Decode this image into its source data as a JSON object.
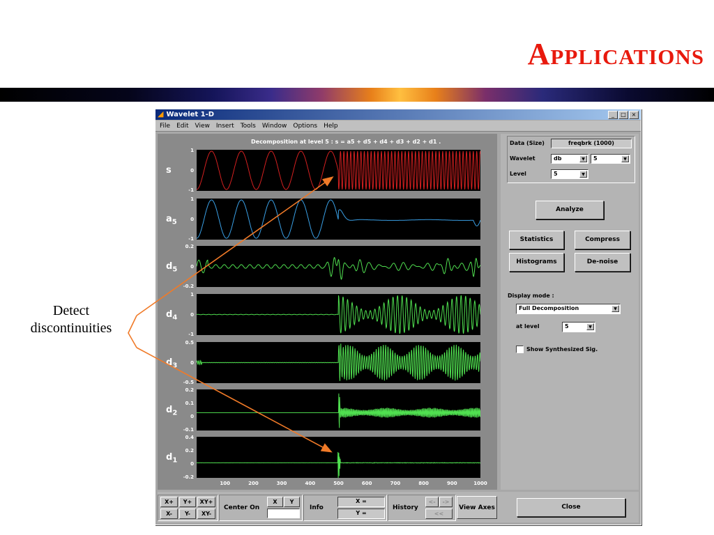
{
  "slide": {
    "title": "Applications",
    "annotation_line1": "Detect",
    "annotation_line2": "discontinuities"
  },
  "colors": {
    "title_red": "#e8190d",
    "arrow_orange": "#f07a28",
    "signal_red": "#d42020",
    "approx_blue": "#3aa0e6",
    "detail_green": "#50e050",
    "titlebar_blue": "#0a2a7a"
  },
  "window": {
    "icon": "matlab-icon",
    "title": "Wavelet 1-D",
    "controls": [
      "_",
      "□",
      "×"
    ],
    "menu": [
      "File",
      "Edit",
      "View",
      "Insert",
      "Tools",
      "Window",
      "Options",
      "Help"
    ]
  },
  "plot_title": "Decomposition at level 5 : s = a5 + d5 + d4 + d3 + d2 + d1 .",
  "subplots": [
    {
      "label": "s",
      "sub": "",
      "yticks": [
        "1",
        "0",
        "-1"
      ]
    },
    {
      "label": "a",
      "sub": "5",
      "yticks": [
        "1",
        "0",
        "-1"
      ]
    },
    {
      "label": "d",
      "sub": "5",
      "yticks": [
        "0.2",
        "0",
        "-0.2"
      ]
    },
    {
      "label": "d",
      "sub": "4",
      "yticks": [
        "1",
        "0",
        "-1"
      ]
    },
    {
      "label": "d",
      "sub": "3",
      "yticks": [
        "0.5",
        "0",
        "-0.5"
      ]
    },
    {
      "label": "d",
      "sub": "2",
      "yticks": [
        "0.2",
        "0.1",
        "0",
        "-0.1"
      ]
    },
    {
      "label": "d",
      "sub": "1",
      "yticks": [
        "0.4",
        "0.2",
        "0",
        "-0.2"
      ]
    }
  ],
  "chart_data": {
    "type": "line",
    "x_range": [
      0,
      1000
    ],
    "discontinuity_at": 500,
    "xticks": [
      "100",
      "200",
      "300",
      "400",
      "500",
      "600",
      "700",
      "800",
      "900",
      "1000"
    ]
  },
  "panel": {
    "data_label": "Data  (Size)",
    "data_value": "freqbrk  (1000)",
    "wavelet_label": "Wavelet",
    "wavelet_family": "db",
    "wavelet_order": "5",
    "level_label": "Level",
    "level_value": "5",
    "analyze": "Analyze",
    "statistics": "Statistics",
    "compress": "Compress",
    "histograms": "Histograms",
    "denoise": "De-noise",
    "display_mode_label": "Display mode :",
    "display_mode_value": "Full Decomposition",
    "at_level_label": "at level",
    "at_level_value": "5",
    "show_synth": "Show Synthesized Sig.",
    "close": "Close"
  },
  "bottom": {
    "zoom": [
      "X+",
      "Y+",
      "XY+",
      "X-",
      "Y-",
      "XY-"
    ],
    "center_on": "Center On",
    "center_x": "X",
    "center_y": "Y",
    "info": "Info",
    "x_eq": "X =",
    "y_eq": "Y =",
    "history": "History",
    "hist_back": "<-",
    "hist_fwd": "->",
    "hist_reset": "<<",
    "view_axes": "View Axes"
  }
}
